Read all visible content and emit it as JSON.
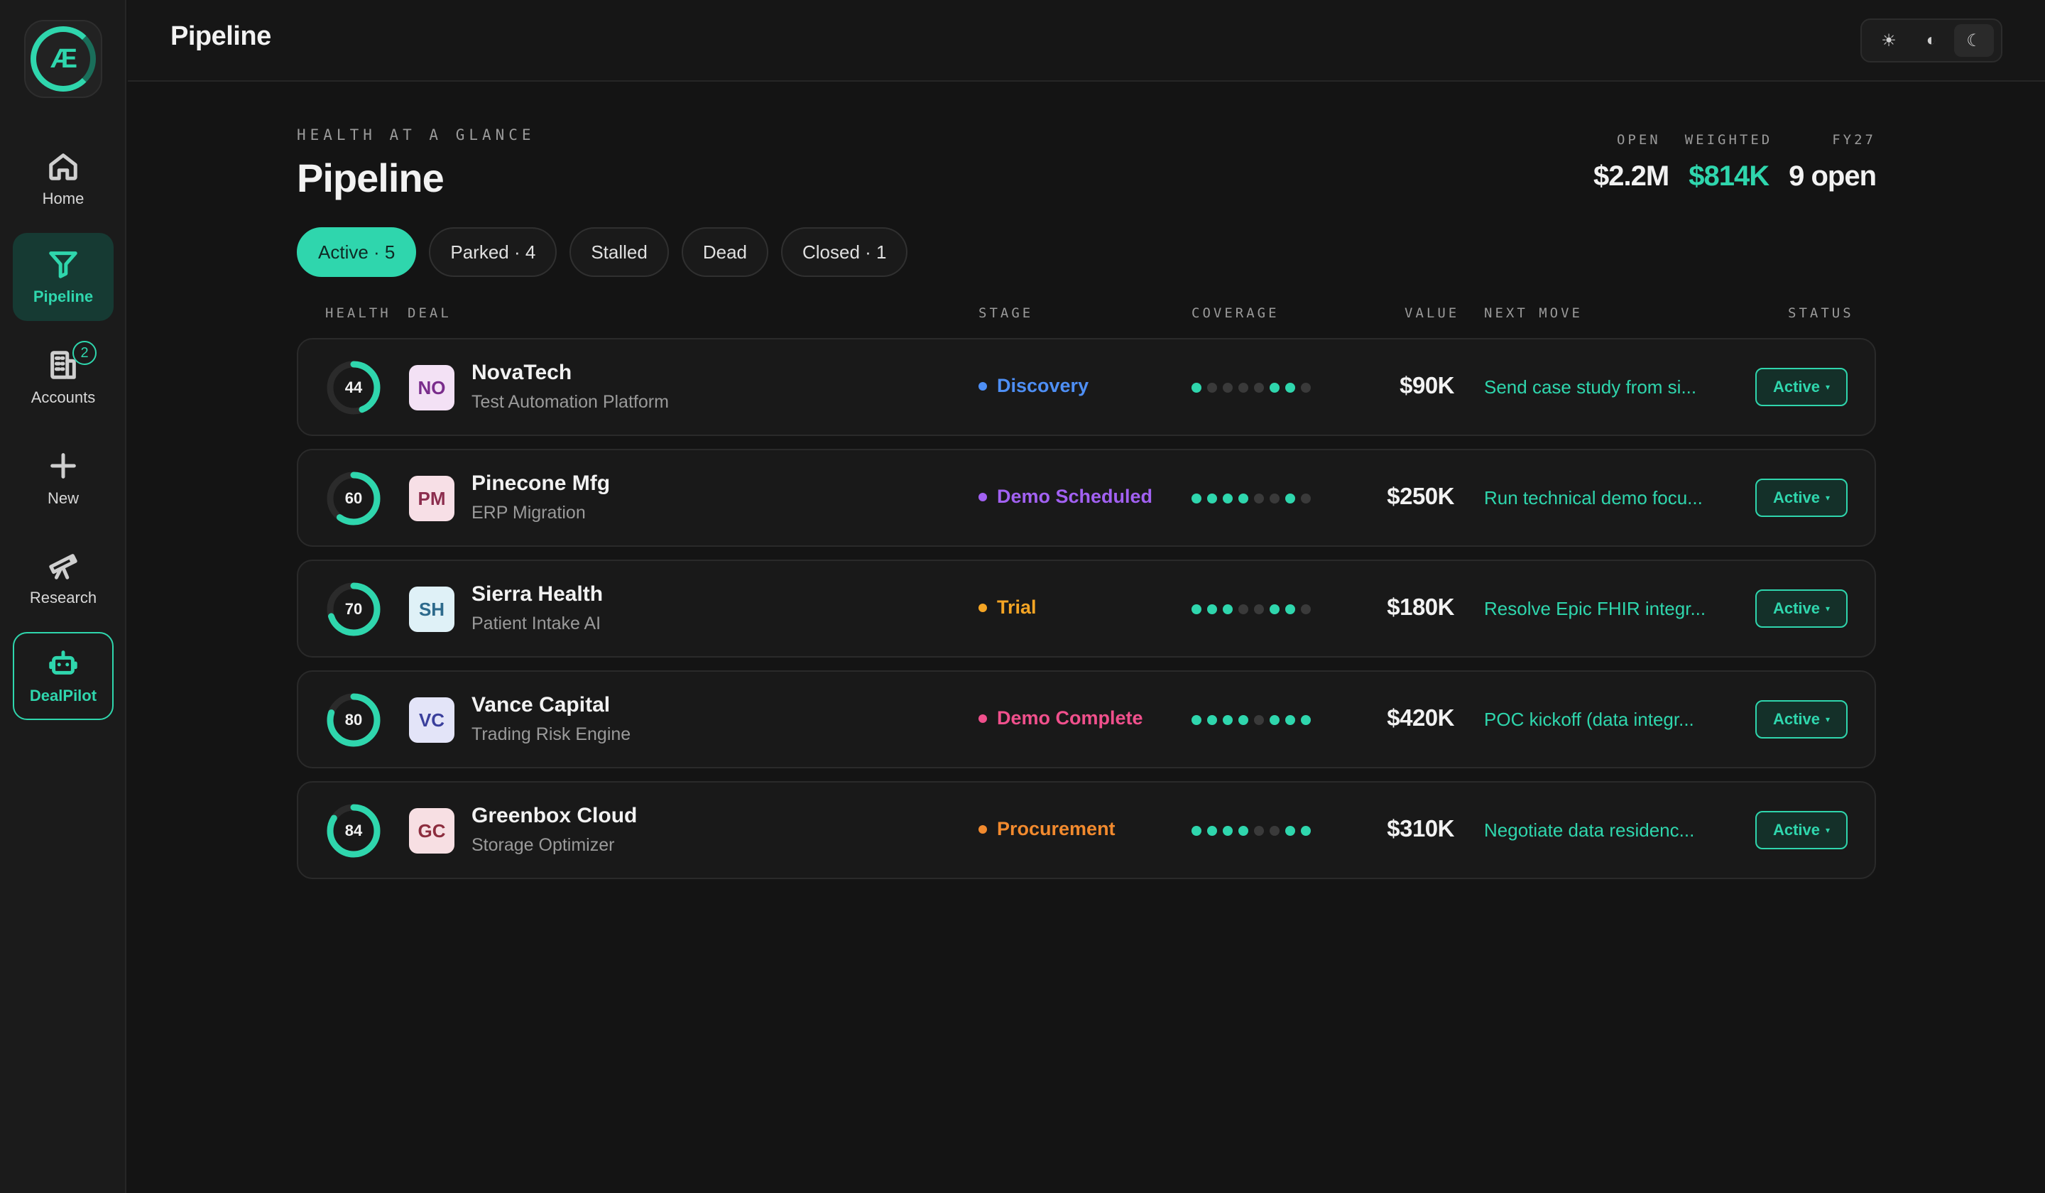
{
  "app": {
    "logo_text": "Æ"
  },
  "sidebar": {
    "items": [
      {
        "label": "Home",
        "icon": "home-icon"
      },
      {
        "label": "Pipeline",
        "icon": "filter-icon",
        "active": true
      },
      {
        "label": "Accounts",
        "icon": "building-icon",
        "badge": "2"
      },
      {
        "label": "New",
        "icon": "plus-icon"
      },
      {
        "label": "Research",
        "icon": "telescope-icon"
      },
      {
        "label": "DealPilot",
        "icon": "robot-icon"
      }
    ]
  },
  "topbar": {
    "title": "Pipeline",
    "theme_options": [
      {
        "icon": "sun-icon",
        "glyph": "☀"
      },
      {
        "icon": "contrast-icon",
        "glyph": "◐"
      },
      {
        "icon": "moon-icon",
        "glyph": "☾",
        "selected": true
      }
    ]
  },
  "header": {
    "eyebrow": "HEALTH AT A GLANCE",
    "title": "Pipeline",
    "stats": {
      "open_label": "OPEN",
      "weighted_label": "WEIGHTED",
      "fy_label": "FY27",
      "open_value": "$2.2M",
      "weighted_value": "$814K",
      "fy_value": "9 open"
    }
  },
  "filters": [
    {
      "label": "Active · 5",
      "active": true
    },
    {
      "label": "Parked · 4"
    },
    {
      "label": "Stalled"
    },
    {
      "label": "Dead"
    },
    {
      "label": "Closed · 1"
    }
  ],
  "table": {
    "headers": {
      "health": "HEALTH",
      "deal": "DEAL",
      "stage": "STAGE",
      "coverage": "COVERAGE",
      "value": "VALUE",
      "next_move": "NEXT MOVE",
      "status": "STATUS"
    },
    "rows": [
      {
        "health": 44,
        "initials": "NO",
        "avatar_bg": "#f3e1f5",
        "avatar_fg": "#7a2d8c",
        "name": "NovaTech",
        "sub": "Test Automation Platform",
        "stage": "Discovery",
        "stage_color": "#4e8ff5",
        "coverage": [
          1,
          0,
          0,
          0,
          0,
          1,
          1,
          0
        ],
        "value": "$90K",
        "next": "Send case study from si...",
        "status": "Active"
      },
      {
        "health": 60,
        "initials": "PM",
        "avatar_bg": "#f7dfe6",
        "avatar_fg": "#8c2d4e",
        "name": "Pinecone Mfg",
        "sub": "ERP Migration",
        "stage": "Demo Scheduled",
        "stage_color": "#a261f2",
        "coverage": [
          1,
          1,
          1,
          1,
          0,
          0,
          1,
          0
        ],
        "value": "$250K",
        "next": "Run technical demo focu...",
        "status": "Active"
      },
      {
        "health": 70,
        "initials": "SH",
        "avatar_bg": "#dff1f7",
        "avatar_fg": "#2d6a8c",
        "name": "Sierra Health",
        "sub": "Patient Intake AI",
        "stage": "Trial",
        "stage_color": "#f5a524",
        "coverage": [
          1,
          1,
          1,
          0,
          0,
          1,
          1,
          0
        ],
        "value": "$180K",
        "next": "Resolve Epic FHIR integr...",
        "status": "Active"
      },
      {
        "health": 80,
        "initials": "VC",
        "avatar_bg": "#e3e4f8",
        "avatar_fg": "#3a3f9c",
        "name": "Vance Capital",
        "sub": "Trading Risk Engine",
        "stage": "Demo Complete",
        "stage_color": "#f0508c",
        "coverage": [
          1,
          1,
          1,
          1,
          0,
          1,
          1,
          1
        ],
        "value": "$420K",
        "next": "POC kickoff (data integr...",
        "status": "Active"
      },
      {
        "health": 84,
        "initials": "GC",
        "avatar_bg": "#f7dfe3",
        "avatar_fg": "#8c2d3e",
        "name": "Greenbox Cloud",
        "sub": "Storage Optimizer",
        "stage": "Procurement",
        "stage_color": "#f28a2e",
        "coverage": [
          1,
          1,
          1,
          1,
          0,
          0,
          1,
          1
        ],
        "value": "$310K",
        "next": "Negotiate data residenc...",
        "status": "Active"
      }
    ]
  },
  "colors": {
    "accent": "#2fd6ad",
    "track": "#2b2b2b"
  }
}
